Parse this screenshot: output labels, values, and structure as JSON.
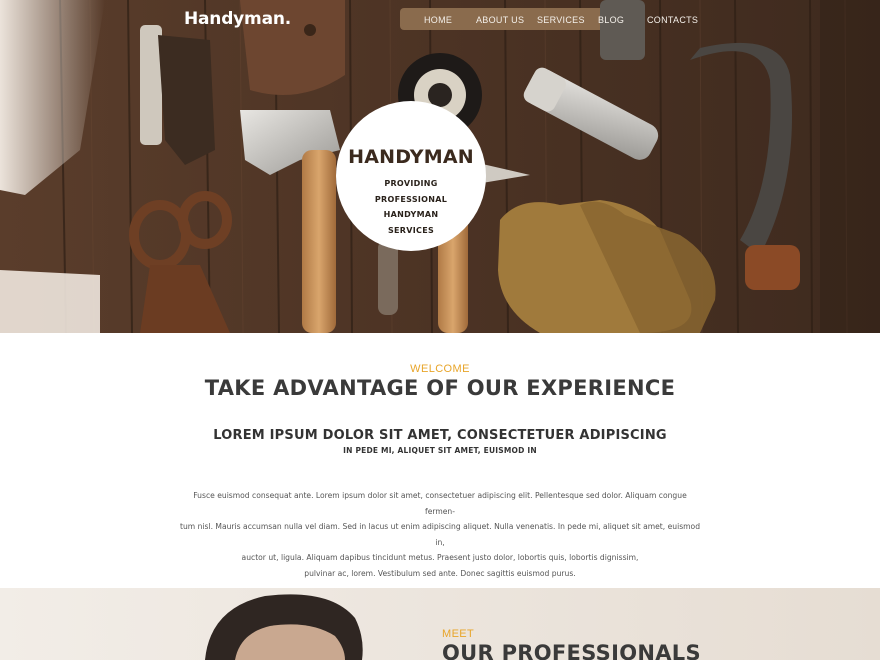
{
  "brand": {
    "logo": "Handyman."
  },
  "nav": {
    "items": [
      {
        "label": "HOME"
      },
      {
        "label": "ABOUT US"
      },
      {
        "label": "SERVICES"
      },
      {
        "label": "BLOG"
      },
      {
        "label": "CONTACTS"
      }
    ]
  },
  "hero": {
    "badge_title": "HANDYMAN",
    "badge_lines": [
      "PROVIDING",
      "PROFESSIONAL",
      "HANDYMAN",
      "SERVICES"
    ]
  },
  "welcome": {
    "kicker": "WELCOME",
    "title": "TAKE ADVANTAGE OF OUR EXPERIENCE",
    "subtitle": "LOREM IPSUM DOLOR SIT AMET, CONSECTETUER ADIPISCING",
    "tagline": "IN PEDE MI, ALIQUET SIT AMET, EUISMOD IN",
    "paragraph_lines": [
      "Fusce euismod consequat ante. Lorem ipsum dolor sit amet, consectetuer adipiscing elit. Pellentesque sed dolor. Aliquam congue fermen-",
      "tum nisl. Mauris accumsan nulla vel diam. Sed in lacus ut enim adipiscing aliquet. Nulla venenatis. In pede mi, aliquet sit amet, euismod in,",
      "auctor ut, ligula. Aliquam dapibus tincidunt metus. Praesent justo dolor, lobortis quis, lobortis dignissim,",
      "pulvinar ac, lorem. Vestibulum sed ante. Donec sagittis euismod purus."
    ]
  },
  "professionals": {
    "kicker": "MEET",
    "title": "OUR PROFESSIONALS"
  },
  "colors": {
    "accent": "#e8a52a",
    "wood_dark": "#3b2a1e",
    "heading": "#3a3a3a",
    "section_bg": "#ede6de"
  },
  "icons": {
    "hero_image": "tools-on-wood-photo",
    "professional_image": "professional-portrait-photo"
  }
}
